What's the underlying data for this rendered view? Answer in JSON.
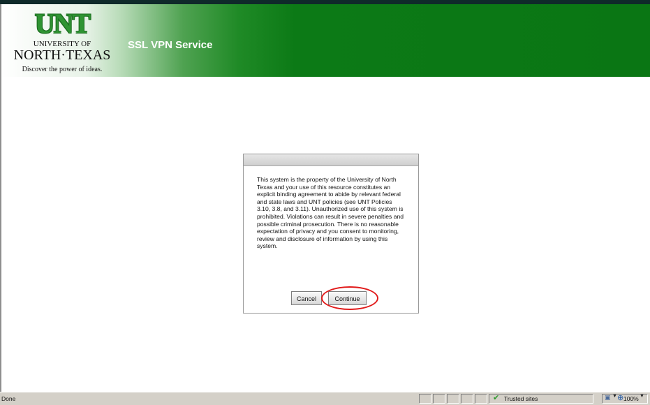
{
  "header": {
    "logo": {
      "wordmark": "UNT",
      "university_of": "UNIVERSITY OF",
      "north_texas": "NORTH·TEXAS",
      "tagline": "Discover the power of ideas."
    },
    "service_title": "SSL VPN Service"
  },
  "dialog": {
    "message": "This system is the property of the University of North Texas and your use of this resource constitutes an explicit binding agreement to abide by relevant federal and state laws and UNT policies (see UNT Policies 3.10, 3.8, and 3.11). Unauthorized use of this system is prohibited. Violations can result in severe penalties and possible criminal prosecution. There is no reasonable expectation of privacy and you consent to monitoring, review and disclosure of information by using this system.",
    "cancel_label": "Cancel",
    "continue_label": "Continue"
  },
  "status_bar": {
    "status_text": "Done",
    "zone_label": "Trusted sites",
    "zoom_label": "100%"
  },
  "colors": {
    "header_green": "#0a7614",
    "logo_green": "#2f9433",
    "highlight_red": "#e11a1a"
  },
  "icons": {
    "zone": "checkmark-icon",
    "protected_mode": "page-protect-icon",
    "zoom": "zoom-icon"
  }
}
